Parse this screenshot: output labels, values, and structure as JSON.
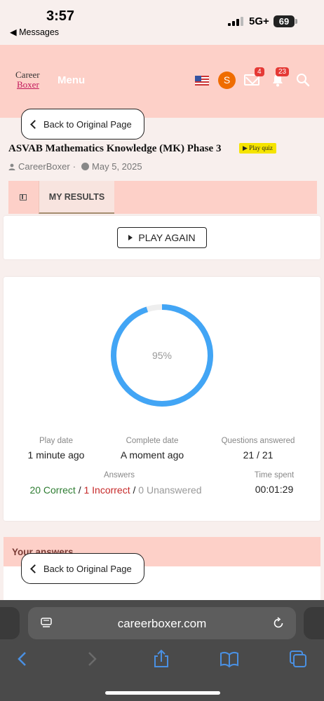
{
  "status_bar": {
    "time": "3:57",
    "back_app": "◀ Messages",
    "network": "5G+",
    "battery": "69"
  },
  "header": {
    "logo_line1": "Career",
    "logo_line2": "Boxer",
    "menu_label": "Menu",
    "avatar_initial": "S",
    "mail_count": "4",
    "notification_count": "23"
  },
  "back_button_label": "Back to Original Page",
  "quiz": {
    "title": "ASVAB Mathematics Knowledge (MK) Phase 3",
    "play_badge": "▶ Play quiz",
    "author": "CareerBoxer",
    "separator": "·",
    "date": "May 5, 2025"
  },
  "tabs": {
    "active": "MY RESULTS"
  },
  "play_again_label": "PLAY AGAIN",
  "results": {
    "score_percent": 95,
    "score_label": "95%",
    "ring_color": "#42a5f5",
    "play_date_label": "Play date",
    "play_date_value": "1 minute ago",
    "complete_date_label": "Complete date",
    "complete_date_value": "A moment ago",
    "questions_answered_label": "Questions answered",
    "questions_answered_value": "21 / 21",
    "answers_label": "Answers",
    "correct": "20 Correct",
    "incorrect": "1 Incorrect",
    "unanswered": "0 Unanswered",
    "slash": "/",
    "time_spent_label": "Time spent",
    "time_spent_value": "00:01:29"
  },
  "your_answers_label": "Your answers",
  "safari": {
    "url": "careerboxer.com"
  }
}
